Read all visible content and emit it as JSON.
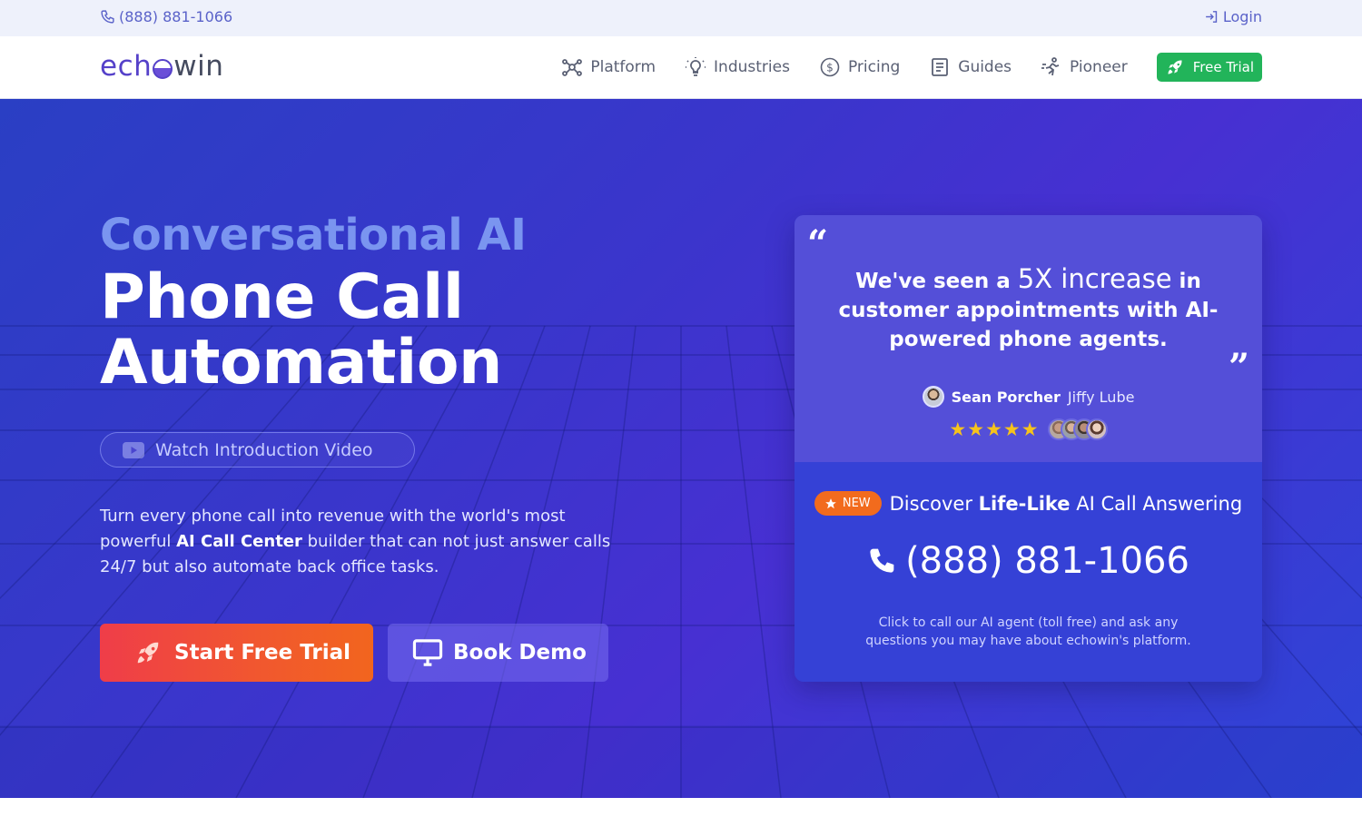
{
  "topbar": {
    "phone": "(888) 881-1066",
    "login": "Login"
  },
  "nav": {
    "logo_prefix": "ech",
    "logo_suffix": "win",
    "items": [
      {
        "label": "Platform",
        "icon": "network-icon"
      },
      {
        "label": "Industries",
        "icon": "lightbulb-icon"
      },
      {
        "label": "Pricing",
        "icon": "dollar-circle-icon"
      },
      {
        "label": "Guides",
        "icon": "book-icon"
      },
      {
        "label": "Pioneer",
        "icon": "runner-icon"
      }
    ],
    "free_trial": "Free Trial"
  },
  "hero": {
    "eyebrow": "Conversational AI",
    "headline_line1": "Phone Call",
    "headline_line2": "Automation",
    "video_label": "Watch Introduction Video",
    "desc_part1": "Turn every phone call into revenue with the world's most powerful ",
    "desc_bold": "AI Call Center",
    "desc_part2": " builder that can not just answer calls 24/7 but also automate back office tasks.",
    "cta_trial": "Start Free Trial",
    "cta_demo": "Book Demo"
  },
  "testimonial": {
    "quote_part1": "We've seen a ",
    "quote_big": "5X increase",
    "quote_part2": " in customer appointments with AI-powered phone agents.",
    "author_name": "Sean Porcher",
    "author_company": "Jiffy Lube",
    "rating": 5
  },
  "callout": {
    "badge": "NEW",
    "discover_part1": "Discover ",
    "discover_bold": "Life-Like",
    "discover_part2": " AI Call Answering",
    "phone": "(888) 881-1066",
    "note": "Click to call our AI agent (toll free) and ask any questions you may have about echowin's platform."
  },
  "colors": {
    "brand": "#5541c9",
    "accent_green": "#22b45a",
    "cta_orange": "#f2651e",
    "star": "#f6c31c"
  }
}
